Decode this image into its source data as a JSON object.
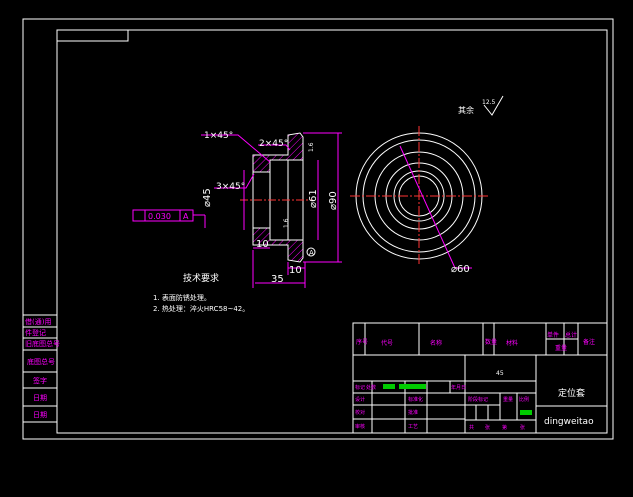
{
  "colors": {
    "background": "#000000",
    "frame": "#ffffff",
    "dimension": "#ff00ff",
    "part": "#ffffff",
    "hatch": "#ff00ff",
    "centerline": "#ff3333",
    "title_text": "#ff00ff",
    "green_cell": "#00cc00",
    "yellow_line": "#ffff00"
  },
  "front_view": {
    "dims": {
      "chamfer_1": "1×45°",
      "chamfer_2": "2×45°",
      "chamfer_3": "3×45°",
      "dia_45": "⌀45",
      "dia_61": "⌀61",
      "dia_90": "⌀90",
      "len_10_left": "10",
      "len_10_right": "10",
      "len_35": "35",
      "tolerance_value": "0.030",
      "tolerance_ref": "A",
      "roughness_1": "1.6",
      "roughness_2": "1.6",
      "datum": "A"
    }
  },
  "side_view": {
    "dim_label": "⌀60"
  },
  "roughness_note": {
    "label": "其余",
    "value": "12.5"
  },
  "tech_req": {
    "title": "技术要求",
    "items": [
      "1. 表面防锈处理。",
      "2. 热处理：淬火HRC58~42。"
    ]
  },
  "left_strip": {
    "cells": [
      "借(通)用",
      "件登记",
      "旧底图总号",
      "底图总号",
      "签字",
      "日期",
      "日期"
    ]
  },
  "title_block": {
    "header": [
      "序号",
      "代号",
      "名称",
      "数量",
      "材料",
      "单件",
      "总计",
      "备注"
    ],
    "sub_header": [
      "重量"
    ],
    "material": "45",
    "part_name": "定位套",
    "drawing_no": "dingweitao",
    "rows_left": [
      "设计",
      "标准化",
      "校对",
      "审核",
      "工艺",
      "批准"
    ],
    "rows_mid": [
      "阶段标记",
      "重量",
      "比例"
    ],
    "footer": [
      "共",
      "张",
      "第",
      "张"
    ],
    "revision": [
      "标记",
      "处数",
      "分区",
      "更改文件号",
      "签名",
      "年月日"
    ]
  }
}
